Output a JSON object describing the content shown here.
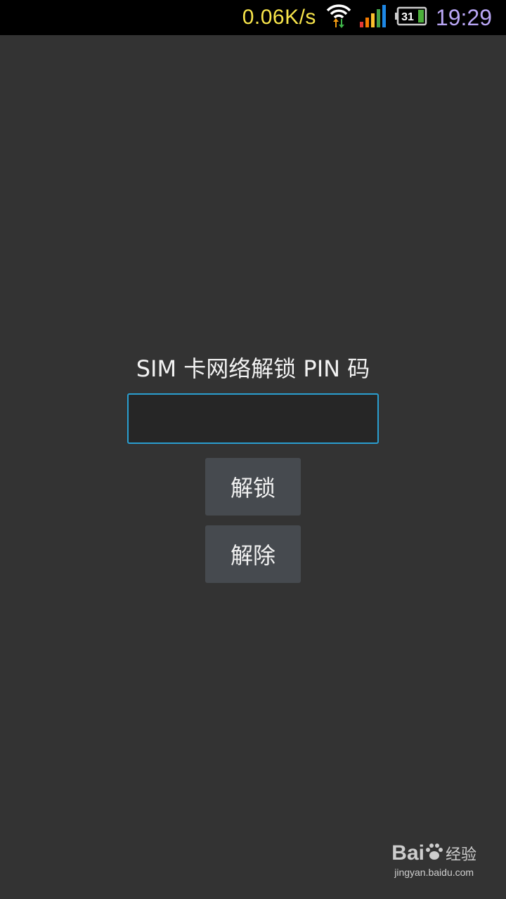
{
  "status_bar": {
    "net_speed": "0.06K/s",
    "battery_level": "31",
    "time": "19:29",
    "icons": [
      "wifi-icon",
      "signal-icon",
      "battery-icon"
    ],
    "colors": {
      "net_speed": "#f7e44a",
      "time": "#b9a6f5",
      "battery": "#4caf3a"
    }
  },
  "dialog": {
    "prompt": "SIM 卡网络解锁 PIN 码",
    "pin_value": "",
    "unlock_label": "解锁",
    "dismiss_label": "解除",
    "colors": {
      "input_border": "#2a9ed0",
      "button_bg": "#464a4f"
    }
  },
  "watermark": {
    "brand": "Bai",
    "brand_suffix": "经验",
    "url": "jingyan.baidu.com",
    "icon": "paw-icon"
  }
}
